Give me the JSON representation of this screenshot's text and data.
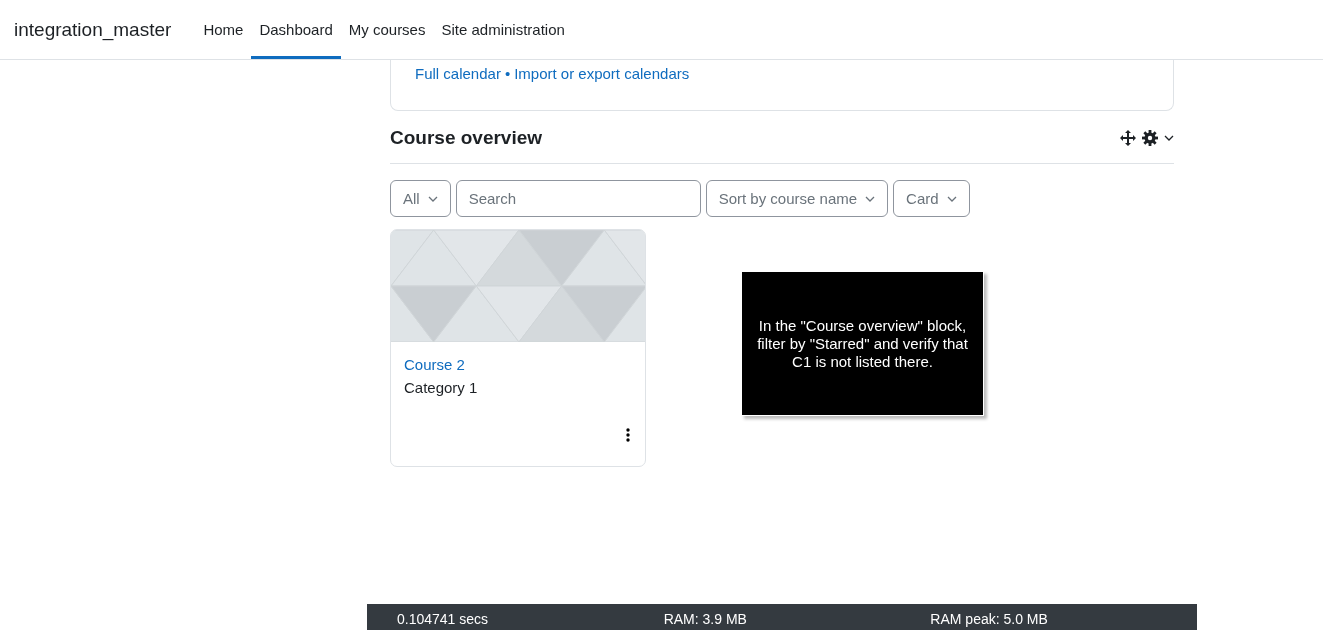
{
  "navbar": {
    "site_name": "integration_master",
    "items": [
      {
        "label": "Home",
        "selected": false
      },
      {
        "label": "Dashboard",
        "selected": true
      },
      {
        "label": "My courses",
        "selected": false
      },
      {
        "label": "Site administration",
        "selected": false
      }
    ]
  },
  "calendar_block": {
    "links": [
      "Full calendar",
      "Import or export calendars"
    ],
    "separator": "•"
  },
  "course_overview": {
    "title": "Course overview",
    "filters": [
      {
        "kind": "dropdown",
        "label": "All"
      },
      {
        "kind": "search",
        "placeholder": "Search"
      },
      {
        "kind": "dropdown",
        "label": "Sort by course name"
      },
      {
        "kind": "dropdown",
        "label": "Card"
      }
    ],
    "courses": [
      {
        "name": "Course 2",
        "category": "Category 1"
      }
    ]
  },
  "tooltip": {
    "text": "In the \"Course overview\" block, filter by \"Starred\" and verify that C1 is not listed there."
  },
  "footer": {
    "stats": [
      "0.104741 secs",
      "RAM: 3.9 MB",
      "RAM peak: 5.0 MB"
    ]
  }
}
